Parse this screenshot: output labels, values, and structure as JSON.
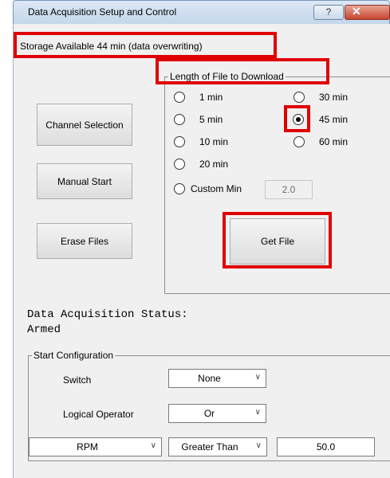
{
  "window": {
    "title": "Data Acquisition Setup and Control",
    "help_label": "?",
    "close_label": "✕"
  },
  "storage_text": "Storage Available 44 min (data overwriting)",
  "buttons": {
    "channel_selection": "Channel Selection",
    "manual_start": "Manual Start",
    "erase_files": "Erase Files",
    "get_file": "Get File"
  },
  "file_length": {
    "legend": "Length of File to Download",
    "options": [
      "1 min",
      "5 min",
      "10 min",
      "20 min",
      "30 min",
      "45 min",
      "60 min",
      "Custom Min"
    ],
    "selected": "45 min",
    "custom_value": "2.0"
  },
  "status": {
    "label": "Data Acquisition Status:",
    "value": "Armed"
  },
  "start_config": {
    "legend": "Start Configuration",
    "switch_label": "Switch",
    "switch_value": "None",
    "logical_operator_label": "Logical Operator",
    "logical_operator_value": "Or",
    "channel_value": "RPM",
    "comparison_value": "Greater Than",
    "threshold_value": "50.0"
  },
  "colors": {
    "highlight": "#e00000"
  }
}
